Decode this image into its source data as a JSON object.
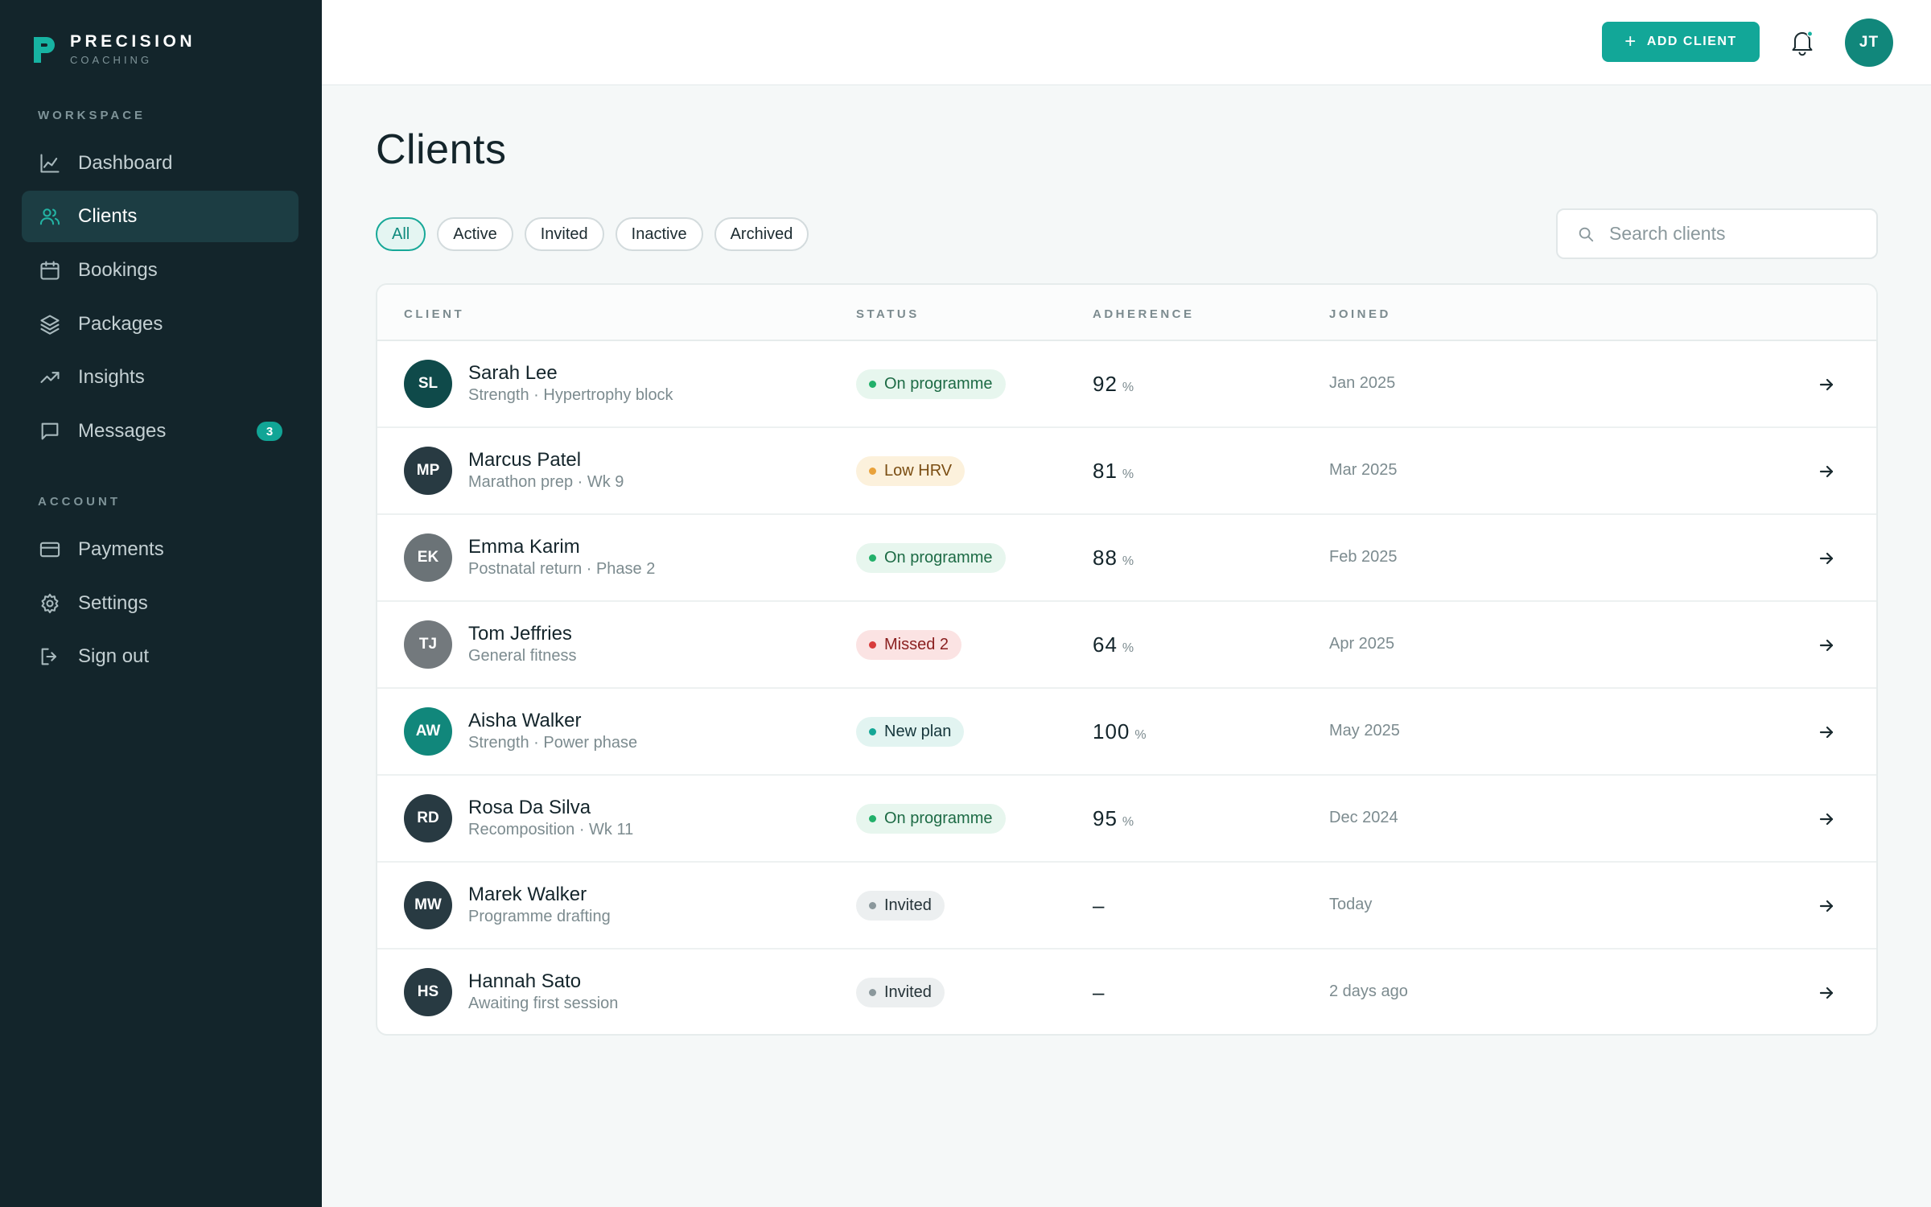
{
  "brand": {
    "name": "PRECISION",
    "sub": "COACHING"
  },
  "sidebar": {
    "workspace_label": "WORKSPACE",
    "account_label": "ACCOUNT",
    "workspace_items": [
      {
        "label": "Dashboard",
        "icon": "chart-line-icon"
      },
      {
        "label": "Clients",
        "icon": "users-icon",
        "active": true
      },
      {
        "label": "Bookings",
        "icon": "calendar-icon"
      },
      {
        "label": "Packages",
        "icon": "layers-icon"
      },
      {
        "label": "Insights",
        "icon": "trending-up-icon"
      },
      {
        "label": "Messages",
        "icon": "message-icon",
        "badge": "3"
      }
    ],
    "account_items": [
      {
        "label": "Payments",
        "icon": "credit-card-icon"
      },
      {
        "label": "Settings",
        "icon": "gear-icon"
      },
      {
        "label": "Sign out",
        "icon": "sign-out-icon"
      }
    ]
  },
  "header": {
    "add_label": "ADD CLIENT",
    "avatar": "JT"
  },
  "main": {
    "title": "Clients",
    "filters": [
      "All",
      "Active",
      "Invited",
      "Inactive",
      "Archived"
    ],
    "search_placeholder": "Search clients",
    "columns": [
      "CLIENT",
      "STATUS",
      "ADHERENCE",
      "JOINED"
    ],
    "rows": [
      {
        "initials": "SL",
        "name": "Sarah Lee",
        "sub": "Strength · Hypertrophy block",
        "status": "On programme",
        "tone": "green",
        "adherence": "92",
        "unit": "%",
        "joined": "Jan 2025",
        "avatar_color": "#0f4a4a"
      },
      {
        "initials": "MP",
        "name": "Marcus Patel",
        "sub": "Marathon prep · Wk 9",
        "status": "Low HRV",
        "tone": "amber",
        "adherence": "81",
        "unit": "%",
        "joined": "Mar 2025",
        "avatar_color": "#283a42"
      },
      {
        "initials": "EK",
        "name": "Emma Karim",
        "sub": "Postnatal return · Phase 2",
        "status": "On programme",
        "tone": "green",
        "adherence": "88",
        "unit": "%",
        "joined": "Feb 2025",
        "avatar_color": "#6b7377"
      },
      {
        "initials": "TJ",
        "name": "Tom Jeffries",
        "sub": "General fitness",
        "status": "Missed 2",
        "tone": "red",
        "adherence": "64",
        "unit": "%",
        "joined": "Apr 2025",
        "avatar_color": "#73797d"
      },
      {
        "initials": "AW",
        "name": "Aisha Walker",
        "sub": "Strength · Power phase",
        "status": "New plan",
        "tone": "teal",
        "adherence": "100",
        "unit": "%",
        "joined": "May 2025",
        "avatar_color": "#11877b"
      },
      {
        "initials": "RD",
        "name": "Rosa Da Silva",
        "sub": "Recomposition · Wk 11",
        "status": "On programme",
        "tone": "green",
        "adherence": "95",
        "unit": "%",
        "joined": "Dec 2024",
        "avatar_color": "#283a42"
      },
      {
        "initials": "MW",
        "name": "Marek Walker",
        "sub": "Programme drafting",
        "status": "Invited",
        "tone": "gray",
        "adherence": "–",
        "unit": "",
        "joined": "Today",
        "avatar_color": "#283a42"
      },
      {
        "initials": "HS",
        "name": "Hannah Sato",
        "sub": "Awaiting first session",
        "status": "Invited",
        "tone": "gray",
        "adherence": "–",
        "unit": "",
        "joined": "2 days ago",
        "avatar_color": "#283a42"
      }
    ]
  },
  "colors": {
    "accent": "#12a798",
    "sidebar": "#13252b",
    "active_nav": "#1c3d43"
  }
}
